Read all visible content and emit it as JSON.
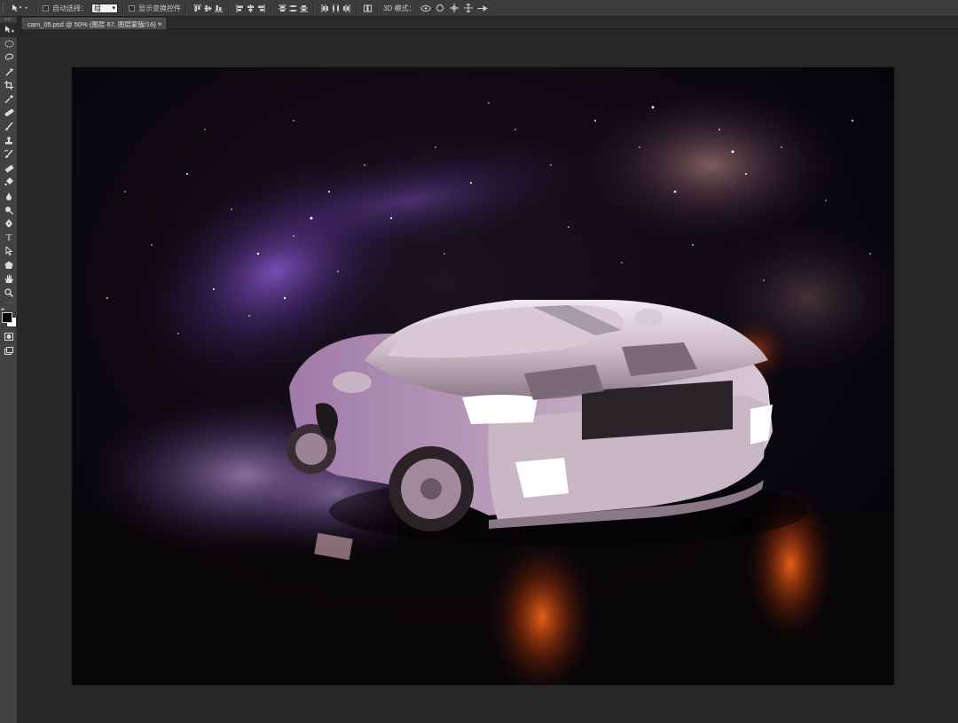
{
  "options_bar": {
    "tool_preset_icon": "move-tool-icon",
    "auto_select_label": "自动选择：",
    "auto_select_value": "组",
    "show_transform_label": "显示变换控件",
    "align_icons": [
      "align-top-icon",
      "align-vcenter-icon",
      "align-bottom-icon",
      "align-left-icon",
      "align-hcenter-icon",
      "align-right-icon"
    ],
    "distribute_icons": [
      "dist-top-icon",
      "dist-vcenter-icon",
      "dist-bottom-icon",
      "dist-left-icon",
      "dist-hcenter-icon",
      "dist-right-icon"
    ],
    "auto_align_icon": "auto-align-icon",
    "mode_3d_label": "3D 模式：",
    "mode_3d_icons": [
      "3d-rotate-icon",
      "3d-roll-icon",
      "3d-pan-icon",
      "3d-slide-icon",
      "3d-scale-icon"
    ]
  },
  "document_tab": {
    "title": "cam_05.psd @ 50% (图层 67, 图层蒙版/16) *",
    "close": "×"
  },
  "toolbar": {
    "tools": [
      "move-tool-icon",
      "marquee-tool-icon",
      "lasso-tool-icon",
      "quick-select-tool-icon",
      "crop-tool-icon",
      "eyedropper-tool-icon",
      "healing-brush-tool-icon",
      "brush-tool-icon",
      "clone-stamp-tool-icon",
      "history-brush-tool-icon",
      "eraser-tool-icon",
      "paint-bucket-tool-icon",
      "blur-tool-icon",
      "dodge-tool-icon",
      "pen-tool-icon",
      "type-tool-icon",
      "path-select-tool-icon",
      "shape-tool-icon",
      "hand-tool-icon",
      "zoom-tool-icon"
    ],
    "type_tool_glyph": "T",
    "foreground_color": "#000000",
    "background_color": "#ffffff"
  },
  "canvas": {
    "subject": "white sports car drifting in smoke under a starry purple nebula sky, orange light reflections on wet ground"
  }
}
